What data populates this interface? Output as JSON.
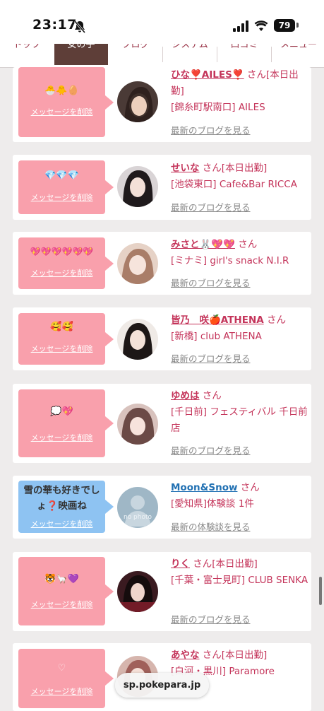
{
  "status_bar": {
    "time": "23:17",
    "battery": "79"
  },
  "tabs": [
    {
      "label": "トップ"
    },
    {
      "label": "女の子"
    },
    {
      "label": "ブログ"
    },
    {
      "label": "システム"
    },
    {
      "label": "口コミ"
    },
    {
      "label": "メニュー"
    }
  ],
  "delete_label": "メッセージを削除",
  "cards": [
    {
      "emoji": "🐣🐥🥚",
      "name": "ひな❣️AILES❣️",
      "suffix": " さん[本日出勤]",
      "shop": "[錦糸町駅南口] AILES",
      "link": "最新のブログを見る"
    },
    {
      "emoji": "💎💎💎",
      "name": "せいな",
      "suffix": " さん[本日出勤]",
      "shop": "[池袋東口] Cafe&Bar RICCA",
      "link": "最新のブログを見る"
    },
    {
      "emoji": "💖💖💖💖💖💖",
      "name": "みさと🐰💖💖",
      "suffix": " さん",
      "shop": "[ミナミ] girl's snack N.I.R",
      "link": "最新のブログを見る"
    },
    {
      "emoji": "🥰🥰",
      "name": "皆乃　咲🍎ATHENA",
      "suffix": " さん",
      "shop": "[新橋] club ATHENA",
      "link": "最新のブログを見る"
    },
    {
      "emoji": "💭💖",
      "name": "ゆめは",
      "suffix": " さん",
      "shop": "[千日前] フェスティバル 千日前店",
      "link": "最新のブログを見る"
    },
    {
      "message": "雪の華も好きでしょ❓映画ね",
      "name": "Moon&Snow",
      "suffix": " さん",
      "shop": "[愛知県]体験談 1件",
      "link": "最新の体験談を見る",
      "avatar_text": "no photo"
    },
    {
      "emoji": "🐯🦙💜",
      "name": "りく",
      "suffix": " さん[本日出勤]",
      "shop": "[千葉・富士見町] CLUB SENKA",
      "link": "最新のブログを見る"
    },
    {
      "emoji": "♡",
      "name": "あやな",
      "suffix": " さん[本日出勤]",
      "shop": "[白河・黒川] Paramore",
      "link": ""
    }
  ],
  "url_bar": "sp.pokepara.jp",
  "colors": {
    "pink_box": "#f9a0ac",
    "blue_box": "#8ec3f2",
    "name_pink": "#c4345a",
    "name_blue": "#2271b3",
    "active_tab": "#5e3e38"
  }
}
